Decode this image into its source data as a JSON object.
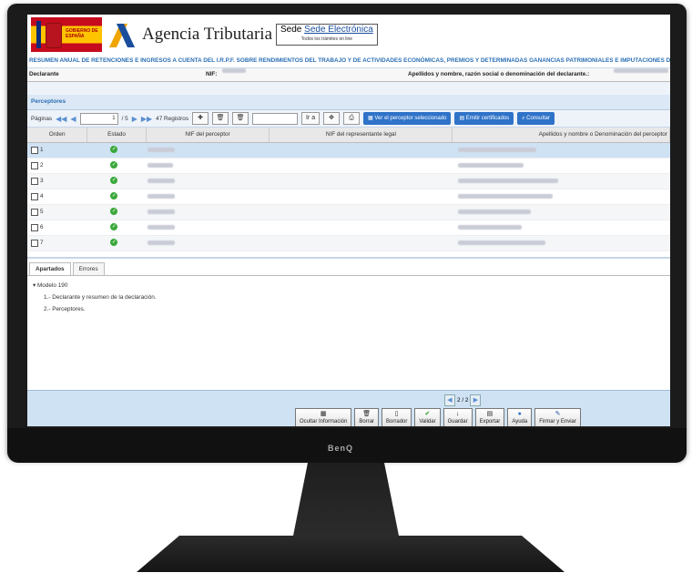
{
  "header": {
    "flag_text": "GOBIERNO DE ESPAÑA",
    "agency": "Agencia Tributaria",
    "sede_title": "Sede Electrónica",
    "sede_sub": "Todos los trámites on line"
  },
  "long_title": "RESUMEN ANUAL DE RETENCIONES E INGRESOS A CUENTA DEL I.R.P.F. SOBRE RENDIMIENTOS DEL TRABAJO Y DE ACTIVIDADES ECONÓMICAS, PREMIOS Y DETERMINADAS GANANCIAS PATRIMONIALES E IMPUTACIONES DE RENTA",
  "declarante": {
    "label": "Declarante",
    "nif_label": "NIF:",
    "name_label": "Apellidos y nombre, razón social o denominación del declarante.:"
  },
  "perceptores": {
    "title": "Perceptores",
    "paginas_label": "Páginas",
    "page_value": "1",
    "page_total": "/ 5",
    "registros": "47 Registros",
    "ir_a": "Ir a",
    "btn_ver": "Ver el perceptor seleccionado",
    "btn_emitir": "Emitir certificados",
    "btn_consultar": "Consultar"
  },
  "columns": [
    "Orden",
    "Estado",
    "NIF del perceptor",
    "NIF del representante legal",
    "Apellidos y nombre o Denominación del perceptor"
  ],
  "rows": [
    {
      "orden": "1"
    },
    {
      "orden": "2"
    },
    {
      "orden": "3"
    },
    {
      "orden": "4"
    },
    {
      "orden": "5"
    },
    {
      "orden": "6"
    },
    {
      "orden": "7"
    }
  ],
  "tabs": [
    "Apartados",
    "Errores"
  ],
  "tree": {
    "root": "Modelo 190",
    "items": [
      "1.- Declarante y resumen de la declaración.",
      "2.- Perceptores."
    ]
  },
  "footer": {
    "pager": "2 / 2",
    "buttons": [
      "Ocultar Información",
      "Borrar",
      "Borrador",
      "Validar",
      "Guardar",
      "Exportar",
      "Ayuda",
      "Firmar y Enviar"
    ]
  },
  "monitor_brand": "BenQ",
  "colors": {
    "accent": "#2f73c8",
    "ok": "#3aa83a",
    "selected_row": "#cfe2f4"
  }
}
